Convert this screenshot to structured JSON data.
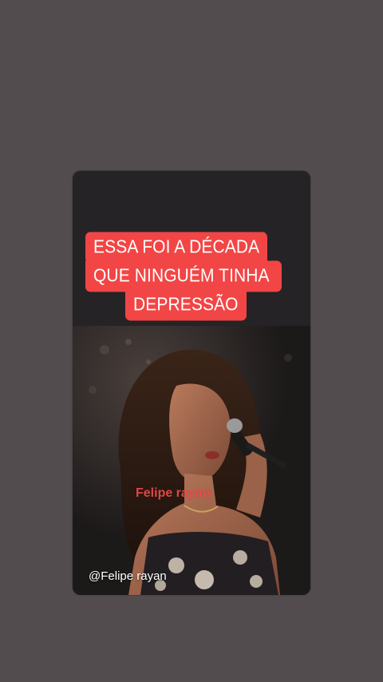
{
  "colors": {
    "background": "#524c4f",
    "caption_bg": "#f24545",
    "caption_text": "#ffffff",
    "watermark": "#f04a4a"
  },
  "caption": {
    "line1": "ESSA FOI A DÉCADA",
    "line2": "QUE NINGUÉM TINHA",
    "line3": "DEPRESSÃO"
  },
  "video": {
    "watermark_center": "Felipe rayan",
    "handle": "@Felipe rayan"
  }
}
